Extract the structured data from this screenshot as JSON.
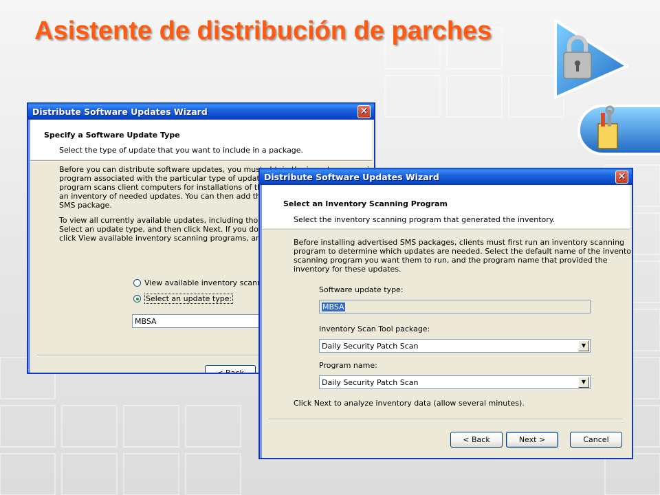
{
  "slide": {
    "title": "Asistente de distribución de parches",
    "title_color": "#ff5a10",
    "badges": [
      "lock-icon",
      "tools-icon"
    ]
  },
  "window_back": {
    "title": "Distribute Software Updates Wizard",
    "close_glyph": "✕",
    "header_title": "Specify a Software Update Type",
    "header_subtitle": "Select the type of update that you want to include in a package.",
    "para1": "Before you can distribute software updates, you must obtain the inventory scanning program associated with the particular type of update you want to distribute. The inventory scanning program scans client computers for installations of the specified software updates and builds an inventory of needed updates. You can then add the updates to your SMS package.",
    "para2": "To view all currently available updates, including those most recently released, you must...\nSelect an update type, and then click Next. If you don't see the update type...\nclick View available inventory scanning programs, and then click Next.",
    "para1_visible": "Before you can distribute software updates, you must obtain the inventory scanning\nprogram associated with the particular type of update you want\nprogram scans client computers for installations of the specifie\nan inventory of needed updates. You can then add the update\nSMS package.",
    "para2_visible": "To view all currently available updates, including those most re\nSelect an update type, and then click Next. If you don't see th\nclick View available inventory scanning programs, and then cl",
    "radio_view": "View available inventory scanning p",
    "radio_select": "Select an update type:",
    "update_type_value": "MBSA",
    "back_label": "< Back"
  },
  "window_front": {
    "title": "Distribute Software Updates Wizard",
    "close_glyph": "✕",
    "header_title": "Select an Inventory Scanning Program",
    "header_subtitle": "Select the inventory scanning program that generated the inventory.",
    "para": "Before installing advertised SMS packages, clients must first run an inventory scanning\nprogram to determine which updates are needed. Select the default name of the inventory\nscanning program you want them to run, and the program name that provided the\ninventory for these updates.",
    "software_update_type_label": "Software update type:",
    "software_update_type_value": "MBSA",
    "inventory_tool_label": "Inventory Scan Tool package:",
    "inventory_tool_value": "Daily Security Patch Scan",
    "program_name_label": "Program name:",
    "program_name_value": "Daily Security Patch Scan",
    "footer_note": "Click Next to analyze inventory data (allow several minutes).",
    "back_label": "< Back",
    "next_label": "Next >",
    "cancel_label": "Cancel"
  }
}
